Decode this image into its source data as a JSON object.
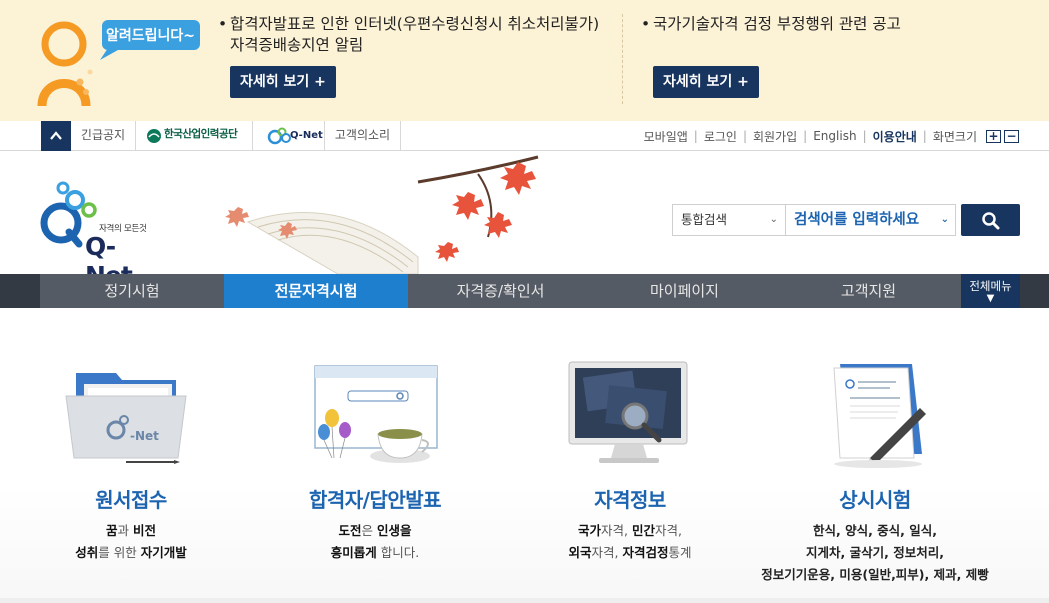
{
  "notice": {
    "mascot_bubble": "알려드립니다~",
    "item1_text": "합격자발표로 인한 인터넷(우편수령신청시 취소처리불가) 자격증배송지연 알림",
    "item1_button": "자세히 보기 +",
    "item2_text": "국가기술자격 검정 부정행위 관련 공고",
    "item2_button": "자세히 보기 +"
  },
  "utilbar": {
    "emergency": "긴급공지",
    "hrdk_logo_text": "한국산업인력공단",
    "qnet_logo_text": "Q-Net",
    "customer_voice": "고객의소리",
    "links": [
      "모바일앱",
      "로그인",
      "회원가입",
      "English",
      "이용안내",
      "화면크기"
    ],
    "zoom_in": "+",
    "zoom_out": "−"
  },
  "header": {
    "logo_tagline": "자격의 모든것",
    "logo_word": "Q-Net",
    "search_scope": "통합검색",
    "search_placeholder": "검색어를 입력하세요"
  },
  "gnb": {
    "tabs": [
      "정기시험",
      "전문자격시험",
      "자격증/확인서",
      "마이페이지",
      "고객지원"
    ],
    "active_index": 1,
    "all_menu": "전체메뉴"
  },
  "cards": [
    {
      "title": "원서접수",
      "lines": [
        [
          "꿈",
          "과 ",
          "비전"
        ],
        [
          "성취",
          "를 위한 ",
          "자기개발"
        ]
      ]
    },
    {
      "title": "합격자/답안발표",
      "lines": [
        [
          "도전",
          "은 ",
          "인생을"
        ],
        [
          "흥미롭게",
          " 합니다.",
          ""
        ]
      ]
    },
    {
      "title": "자격정보",
      "lines": [
        [
          "국가",
          "자격, ",
          "민간",
          "자격,"
        ],
        [
          "외국",
          "자격, ",
          "자격검정",
          "통계"
        ]
      ]
    },
    {
      "title": "상시시험",
      "lines": [
        [
          "한식, 양식, 중식, 일식,"
        ],
        [
          "지게차, 굴삭기, 정보처리,"
        ],
        [
          "정보기기운용, 미용(일반,피부), 제과, 제빵"
        ]
      ]
    }
  ],
  "colors": {
    "navy": "#17355f",
    "accent_blue": "#1f7fcf",
    "title_blue": "#1d64b0",
    "notice_bg": "#fcf2d6"
  }
}
